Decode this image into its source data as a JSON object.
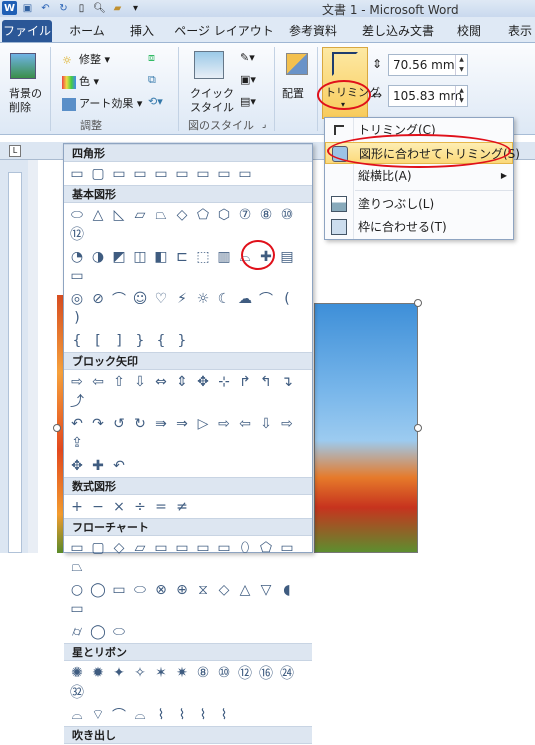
{
  "titlebar": {
    "app_logo": "W",
    "title": "文書 1 - Microsoft Word"
  },
  "tabs": [
    "ファイル",
    "ホーム",
    "挿入",
    "ページ レイアウト",
    "参考資料",
    "差し込み文書",
    "校閲",
    "表示"
  ],
  "ribbon": {
    "remove_bg": [
      "背景の",
      "削除"
    ],
    "adjust": {
      "corrections": "修整",
      "color": "色",
      "artistic": "アート効果",
      "label": "調整"
    },
    "quick_style": [
      "クイック",
      "スタイル"
    ],
    "pic_style_label": "図のスタイル",
    "arrange": "配置",
    "crop": "トリミング",
    "height": "70.56 mm",
    "width": "105.83 mm"
  },
  "crop_menu": [
    {
      "label": "トリミング(C)",
      "icon": "crop-icon"
    },
    {
      "label": "図形に合わせてトリミング(S)",
      "icon": "crop-to-shape-icon",
      "highlighted": true
    },
    {
      "label": "縦横比(A)",
      "icon": "",
      "submenu": true
    },
    {
      "label": "塗りつぶし(L)",
      "icon": "fill-icon"
    },
    {
      "label": "枠に合わせる(T)",
      "icon": "fit-icon"
    }
  ],
  "gallery": {
    "sections": [
      {
        "title": "四角形",
        "rows": [
          [
            "▭",
            "▢",
            "▭",
            "▭",
            "▭",
            "▭",
            "▭",
            "▭",
            "▭"
          ]
        ]
      },
      {
        "title": "基本図形",
        "rows": [
          [
            "⬭",
            "△",
            "◺",
            "▱",
            "⏢",
            "◇",
            "⬠",
            "⬡",
            "⑦",
            "⑧",
            "⑩",
            "⑫"
          ],
          [
            "◔",
            "◑",
            "◩",
            "◫",
            "◧",
            "⊏",
            "⬚",
            "▥",
            "⌓",
            "✚",
            "▤",
            "▭"
          ],
          [
            "◎",
            "⊘",
            "⌒",
            "☺",
            "♡",
            "⚡",
            "☼",
            "☾",
            "☁",
            "⌒",
            "(",
            ")"
          ],
          [
            "{",
            "[",
            "]",
            "}",
            "{",
            "}"
          ]
        ]
      },
      {
        "title": "ブロック矢印",
        "rows": [
          [
            "⇨",
            "⇦",
            "⇧",
            "⇩",
            "⇔",
            "⇕",
            "✥",
            "⊹",
            "↱",
            "↰",
            "↴",
            "⤴"
          ],
          [
            "↶",
            "↷",
            "↺",
            "↻",
            "⇛",
            "⇒",
            "▷",
            "⇨",
            "⇦",
            "⇩",
            "⇨",
            "⇪"
          ],
          [
            "✥",
            "✚",
            "↶"
          ]
        ]
      },
      {
        "title": "数式図形",
        "rows": [
          [
            "+",
            "−",
            "×",
            "÷",
            "=",
            "≠"
          ]
        ]
      },
      {
        "title": "フローチャート",
        "rows": [
          [
            "▭",
            "▢",
            "◇",
            "▱",
            "▭",
            "▭",
            "▭",
            "▭",
            "⬯",
            "⬠",
            "▭",
            "⏢"
          ],
          [
            "○",
            "◯",
            "▭",
            "⬭",
            "⊗",
            "⊕",
            "⧖",
            "◇",
            "△",
            "▽",
            "◖",
            "▭"
          ],
          [
            "⌭",
            "◯",
            "⬭"
          ]
        ]
      },
      {
        "title": "星とリボン",
        "rows": [
          [
            "✺",
            "✹",
            "✦",
            "✧",
            "✶",
            "✷",
            "⑧",
            "⑩",
            "⑫",
            "⑯",
            "㉔",
            "㉜"
          ],
          [
            "⌓",
            "⌔",
            "⌒",
            "⌓",
            "⌇",
            "⌇",
            "⌇",
            "⌇"
          ]
        ]
      },
      {
        "title": "吹き出し",
        "rows": []
      }
    ]
  }
}
